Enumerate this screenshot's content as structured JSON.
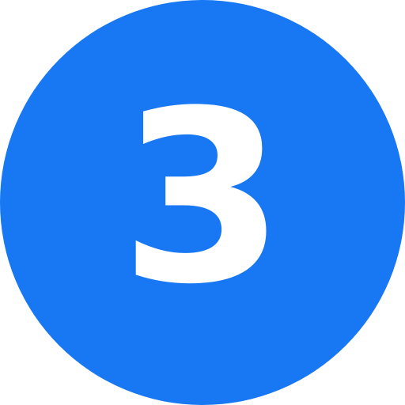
{
  "badge": {
    "number": "3",
    "background_color": "#1877f2",
    "text_color": "#ffffff"
  }
}
